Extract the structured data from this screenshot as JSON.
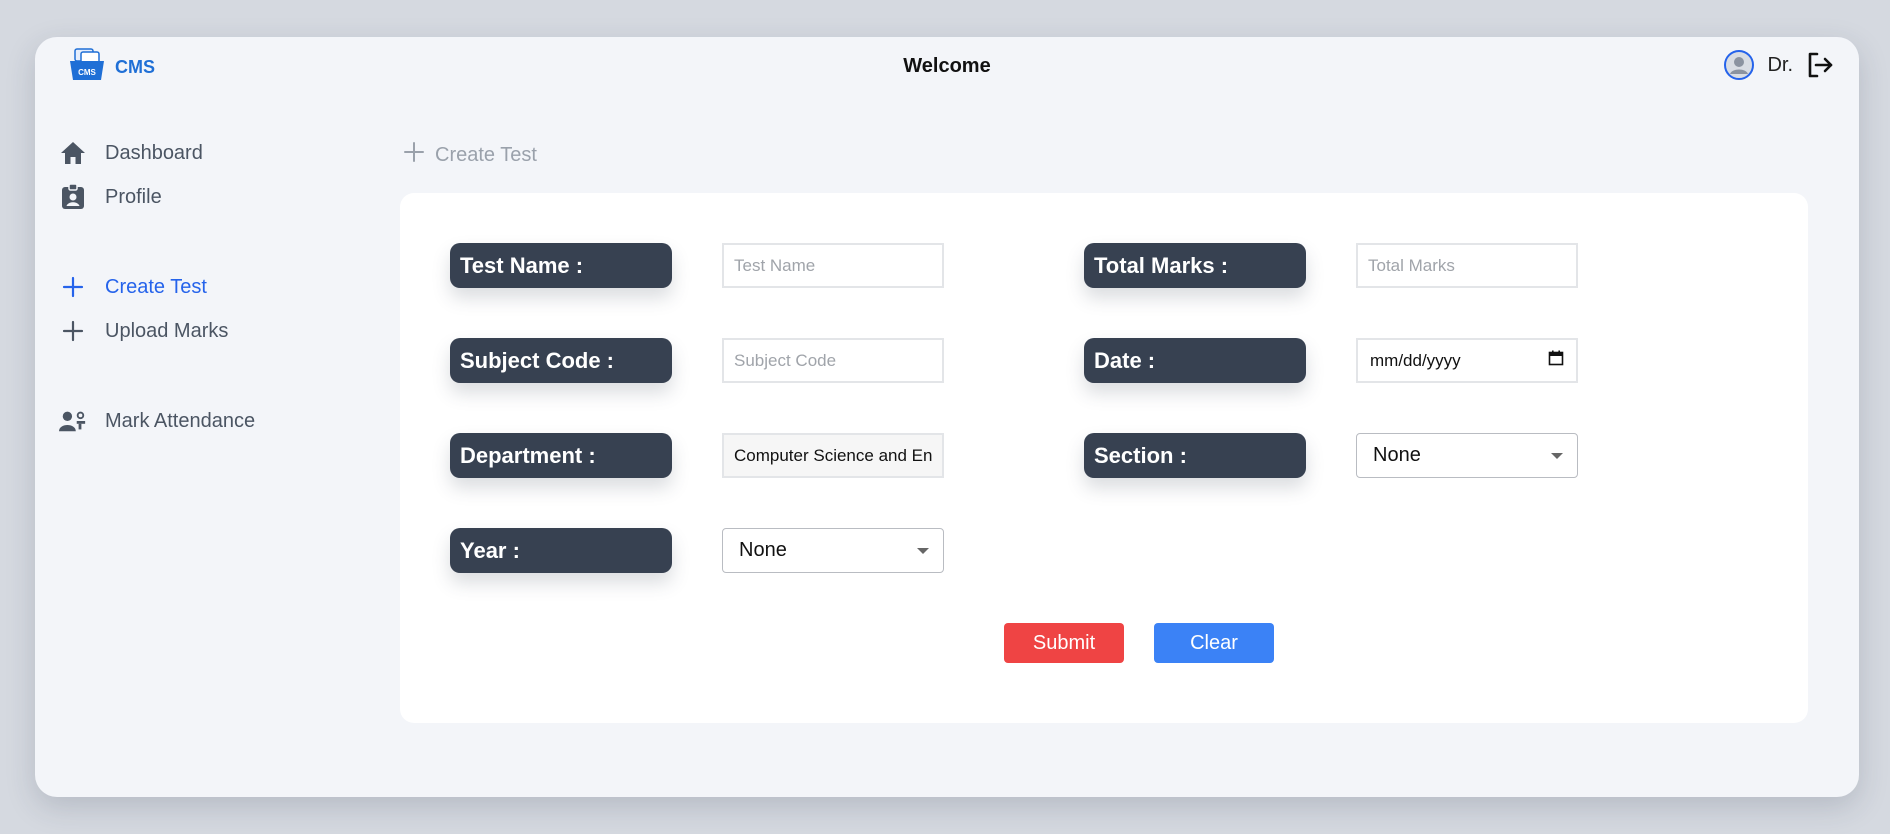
{
  "app": {
    "name": "CMS",
    "logo_badge": "CMS"
  },
  "header": {
    "title": "Welcome",
    "user_name": "Dr."
  },
  "sidebar": {
    "items": [
      {
        "label": "Dashboard",
        "icon": "home-icon"
      },
      {
        "label": "Profile",
        "icon": "profile-badge-icon"
      },
      {
        "label": "Create Test",
        "icon": "plus-icon",
        "active": true
      },
      {
        "label": "Upload Marks",
        "icon": "plus-icon"
      },
      {
        "label": "Mark Attendance",
        "icon": "teacher-icon"
      }
    ]
  },
  "breadcrumb": {
    "label": "Create Test"
  },
  "form": {
    "test_name": {
      "label": "Test Name :",
      "placeholder": "Test Name",
      "value": ""
    },
    "total_marks": {
      "label": "Total Marks :",
      "placeholder": "Total Marks",
      "value": ""
    },
    "subject_code": {
      "label": "Subject Code :",
      "placeholder": "Subject Code",
      "value": ""
    },
    "date": {
      "label": "Date :",
      "placeholder": "mm/dd/yyyy"
    },
    "department": {
      "label": "Department :",
      "value": "Computer Science and Engineering"
    },
    "section": {
      "label": "Section :",
      "selected": "None"
    },
    "year": {
      "label": "Year :",
      "selected": "None"
    }
  },
  "actions": {
    "submit": "Submit",
    "clear": "Clear"
  },
  "colors": {
    "accent": "#2563eb",
    "label_bg": "#374151",
    "submit": "#ef4444",
    "clear": "#3b82f6",
    "logo": "#1f6fd6"
  }
}
